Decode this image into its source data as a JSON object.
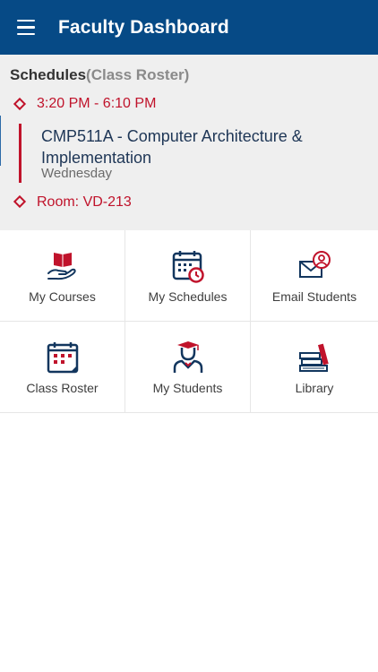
{
  "header": {
    "title": "Faculty Dashboard",
    "menu_icon": "hamburger-menu-icon"
  },
  "schedule": {
    "heading": "Schedules",
    "heading_sub": "(Class Roster)",
    "time": "3:20 PM - 6:10 PM",
    "course": "CMP511A - Computer Architecture & Implementation",
    "day": "Wednesday",
    "room": "Room: VD-213"
  },
  "tiles": [
    {
      "label": "My Courses",
      "icon": "book-hand-icon"
    },
    {
      "label": "My Schedules",
      "icon": "calendar-clock-icon"
    },
    {
      "label": "Email Students",
      "icon": "email-user-icon"
    },
    {
      "label": "Class Roster",
      "icon": "calendar-grid-icon"
    },
    {
      "label": "My Students",
      "icon": "graduate-icon"
    },
    {
      "label": "Library",
      "icon": "books-stack-icon"
    }
  ],
  "colors": {
    "brand": "#064a86",
    "accent": "#c0132b",
    "panel": "#efefef"
  }
}
